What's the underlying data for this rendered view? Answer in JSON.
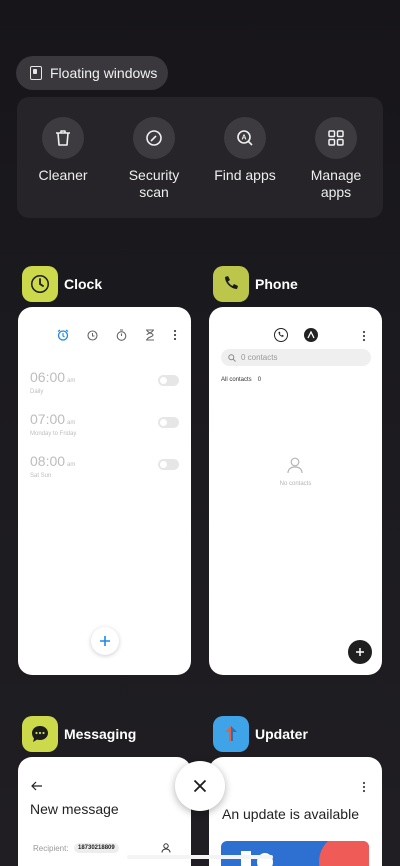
{
  "floating_windows": {
    "label": "Floating windows",
    "icon": "floating-window-icon"
  },
  "tools": [
    {
      "label": "Cleaner",
      "icon": "trash-icon"
    },
    {
      "label": "Security scan",
      "icon": "security-icon"
    },
    {
      "label": "Find apps",
      "icon": "find-apps-icon"
    },
    {
      "label": "Manage apps",
      "icon": "grid-icon"
    }
  ],
  "apps": {
    "clock": {
      "name": "Clock",
      "icon_color": "#cbd94a",
      "alarms": [
        {
          "time": "06:00",
          "ampm": "am",
          "repeat": "Daily"
        },
        {
          "time": "07:00",
          "ampm": "am",
          "repeat": "Monday to Friday"
        },
        {
          "time": "08:00",
          "ampm": "am",
          "repeat": "Sat Sun"
        }
      ]
    },
    "phone": {
      "name": "Phone",
      "icon_color": "#bcc64a",
      "search_placeholder": "0 contacts",
      "all_contacts_label": "All contacts",
      "all_contacts_count": "0",
      "empty_label": "No contacts"
    },
    "messaging": {
      "name": "Messaging",
      "icon_color": "#cbd94a",
      "title": "New message",
      "recipient_label": "Recipient:",
      "recipient_value": "18730218809"
    },
    "updater": {
      "name": "Updater",
      "icon_color": "#3fa3e8",
      "message": "An update is available"
    }
  },
  "accent_color": "#1e88e5"
}
